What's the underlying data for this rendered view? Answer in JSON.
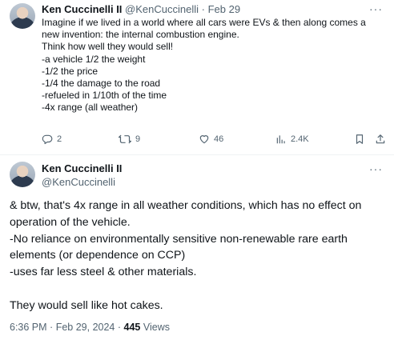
{
  "tweet1": {
    "author_name": "Ken Cuccinelli II",
    "handle": "@KenCuccinelli",
    "separator": "·",
    "date": "Feb 29",
    "text": "Imagine if we lived in a world where all cars were EVs & then along comes a new invention: the internal combustion engine.\nThink how well they would sell!\n-a vehicle 1/2 the weight\n-1/2 the price\n-1/4 the damage to the road\n-refueled in 1/10th of the time\n-4x range (all weather)",
    "more_label": "···",
    "actions": {
      "replies": "2",
      "reposts": "9",
      "likes": "46",
      "views": "2.4K"
    },
    "icons": [
      "reply-icon",
      "repost-icon",
      "like-icon",
      "views-icon",
      "bookmark-icon",
      "share-icon"
    ]
  },
  "tweet2": {
    "author_name": "Ken Cuccinelli II",
    "handle": "@KenCuccinelli",
    "more_label": "···",
    "text": "& btw, that's 4x range in all weather conditions, which has no effect on operation of the vehicle.\n-No reliance on environmentally sensitive non-renewable rare earth elements (or dependence on CCP)\n-uses far less steel & other materials.\n\nThey would sell like hot cakes.",
    "time": "6:36 PM",
    "separator": "·",
    "date": "Feb 29, 2024",
    "views_count": "445",
    "views_label": "Views"
  },
  "colors": {
    "text": "#0f1419",
    "muted": "#536471",
    "divider": "#eff3f4"
  }
}
